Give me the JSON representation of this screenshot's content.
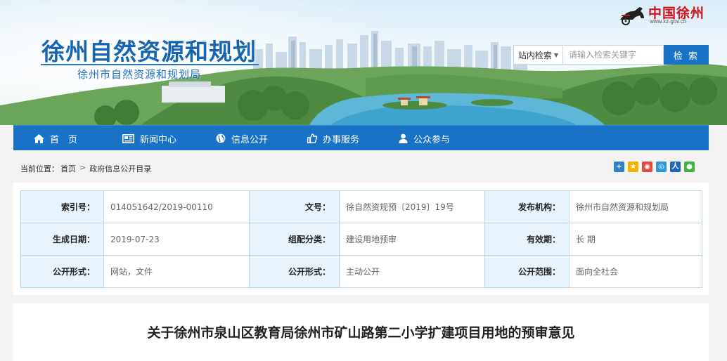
{
  "header": {
    "title": "徐州自然资源和规划",
    "subtitle": "徐州市自然资源和规划局",
    "logo": {
      "text": "中国徐州",
      "url": "www.xz.gov.cn",
      "emblem": "horse-chariot-emblem"
    }
  },
  "search": {
    "scope": "站内检索",
    "placeholder": "请输入检索关键字",
    "button": "检 索"
  },
  "nav": {
    "items": [
      {
        "label": "首　页",
        "icon": "home-icon"
      },
      {
        "label": "新闻中心",
        "icon": "newspaper-icon"
      },
      {
        "label": "信息公开",
        "icon": "globe-icon"
      },
      {
        "label": "办事服务",
        "icon": "thumbs-up-icon"
      },
      {
        "label": "公众参与",
        "icon": "user-icon"
      }
    ]
  },
  "breadcrumb": {
    "prefix": "当前位置：",
    "home": "首页",
    "separator": ">",
    "current": "政府信息公开目录"
  },
  "share": [
    {
      "icon": "plus-share-icon",
      "color": "#2f7fd0"
    },
    {
      "icon": "qzone-star-icon",
      "color": "#f2b400"
    },
    {
      "icon": "weibo-icon",
      "color": "#e24a3b"
    },
    {
      "icon": "tencent-weibo-icon",
      "color": "#2b98d8"
    },
    {
      "icon": "renren-icon",
      "color": "#1e66b8"
    },
    {
      "icon": "wechat-icon",
      "color": "#3fb53a"
    }
  ],
  "info": {
    "row1": {
      "index_label": "索引号：",
      "index_value": "014051642/2019-00110",
      "docno_label": "文号：",
      "docno_value": "徐自然资规预〔2019〕19号",
      "agency_label": "发布机构：",
      "agency_value": "徐州市自然资源和规划局"
    },
    "row2": {
      "date_label": "生成日期：",
      "date_value": "2019-07-23",
      "category_label": "组配分类：",
      "category_value": "建设用地预审",
      "validity_label": "有效期：",
      "validity_value": "长 期"
    },
    "row3": {
      "form_label": "公开形式：",
      "form_value": "网站，文件",
      "method_label": "公开形式：",
      "method_value": "主动公开",
      "scope_label": "公开范围：",
      "scope_value": "面向全社会"
    }
  },
  "article": {
    "title": "关于徐州市泉山区教育局徐州市矿山路第二小学扩建项目用地的预审意见"
  }
}
